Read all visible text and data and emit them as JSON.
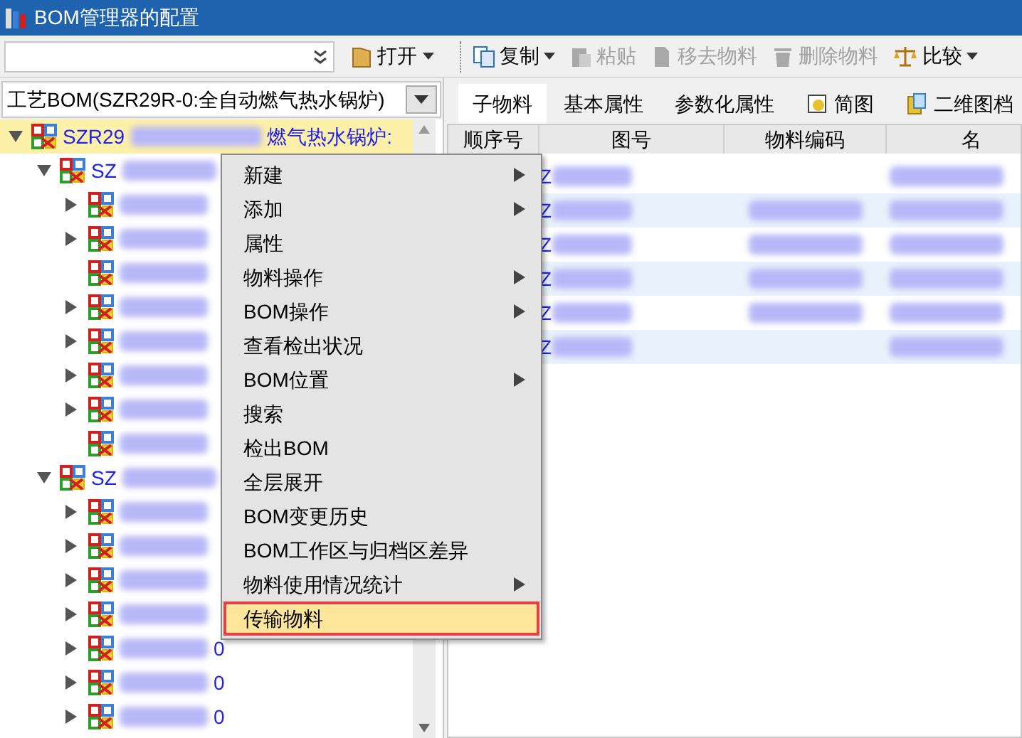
{
  "window": {
    "title": "BOM管理器的配置"
  },
  "left_toolbar": {
    "open_button": "打开"
  },
  "toolbar": [
    {
      "label": "复制",
      "disabled": false,
      "dropdown": true,
      "kind": "copy"
    },
    {
      "label": "粘贴",
      "disabled": true,
      "kind": "paste"
    },
    {
      "label": "移去物料",
      "disabled": true,
      "kind": "remove"
    },
    {
      "label": "删除物料",
      "disabled": true,
      "kind": "delete"
    },
    {
      "label": "比较",
      "disabled": false,
      "dropdown": true,
      "kind": "compare"
    }
  ],
  "bom_select": {
    "value": "工艺BOM(SZR29R-0:全自动燃气热水锅炉)"
  },
  "tree": [
    {
      "prefix": "SZR29",
      "suffix": "燃气热水锅炉:",
      "expanded": true,
      "selected": true,
      "children": [
        {
          "prefix": "SZ",
          "expanded": true,
          "selected": false,
          "children": [
            {
              "expanded": false,
              "selected": false
            },
            {
              "expanded": false,
              "selected": false
            },
            {
              "selected": false
            },
            {
              "expanded": false,
              "selected": false
            },
            {
              "expanded": false,
              "selected": false
            },
            {
              "expanded": false,
              "selected": false
            },
            {
              "expanded": false,
              "selected": false
            },
            {
              "selected": false
            }
          ]
        },
        {
          "prefix": "SZ",
          "expanded": true,
          "selected": false,
          "children": [
            {
              "expanded": false,
              "selected": false
            },
            {
              "expanded": false,
              "selected": false
            },
            {
              "expanded": false,
              "selected": false
            },
            {
              "expanded": false,
              "selected": false
            },
            {
              "suffix": "0",
              "expanded": false,
              "selected": false
            },
            {
              "suffix": "0",
              "expanded": false,
              "selected": false
            },
            {
              "suffix": "0",
              "expanded": false,
              "selected": false
            }
          ]
        }
      ]
    }
  ],
  "tabs": [
    {
      "label": "子物料",
      "selected": true,
      "kind": "plain"
    },
    {
      "label": "基本属性",
      "selected": false,
      "kind": "plain"
    },
    {
      "label": "参数化属性",
      "selected": false,
      "kind": "plain"
    },
    {
      "label": "简图",
      "selected": false,
      "kind": "sketch"
    },
    {
      "label": "二维图档",
      "selected": false,
      "kind": "drawing"
    }
  ],
  "table": {
    "columns": [
      "顺序号",
      "图号",
      "物料编码",
      "名"
    ],
    "rows": [
      {
        "drawing_no": "Z",
        "has_code": false
      },
      {
        "drawing_no": "Z",
        "has_code": true
      },
      {
        "drawing_no": "Z",
        "has_code": true
      },
      {
        "drawing_no": "Z",
        "has_code": true
      },
      {
        "drawing_no": "Z",
        "has_code": true
      },
      {
        "drawing_no": "Z",
        "has_code": false
      }
    ]
  },
  "context_menu": [
    {
      "label": "新建",
      "submenu": true,
      "selected": false
    },
    {
      "label": "添加",
      "submenu": true,
      "selected": false
    },
    {
      "label": "属性",
      "submenu": false,
      "selected": false
    },
    {
      "label": "物料操作",
      "submenu": true,
      "selected": false
    },
    {
      "label": "BOM操作",
      "submenu": true,
      "selected": false
    },
    {
      "label": "查看检出状况",
      "submenu": false,
      "selected": false
    },
    {
      "label": "BOM位置",
      "submenu": true,
      "selected": false
    },
    {
      "label": "搜索",
      "submenu": false,
      "selected": false
    },
    {
      "label": "检出BOM",
      "submenu": false,
      "selected": false
    },
    {
      "label": "全层展开",
      "submenu": false,
      "selected": false
    },
    {
      "label": "BOM变更历史",
      "submenu": false,
      "selected": false
    },
    {
      "label": "BOM工作区与归档区差异",
      "submenu": false,
      "selected": false
    },
    {
      "label": "物料使用情况统计",
      "submenu": true,
      "selected": false
    },
    {
      "label": "传输物料",
      "submenu": false,
      "selected": true
    }
  ]
}
